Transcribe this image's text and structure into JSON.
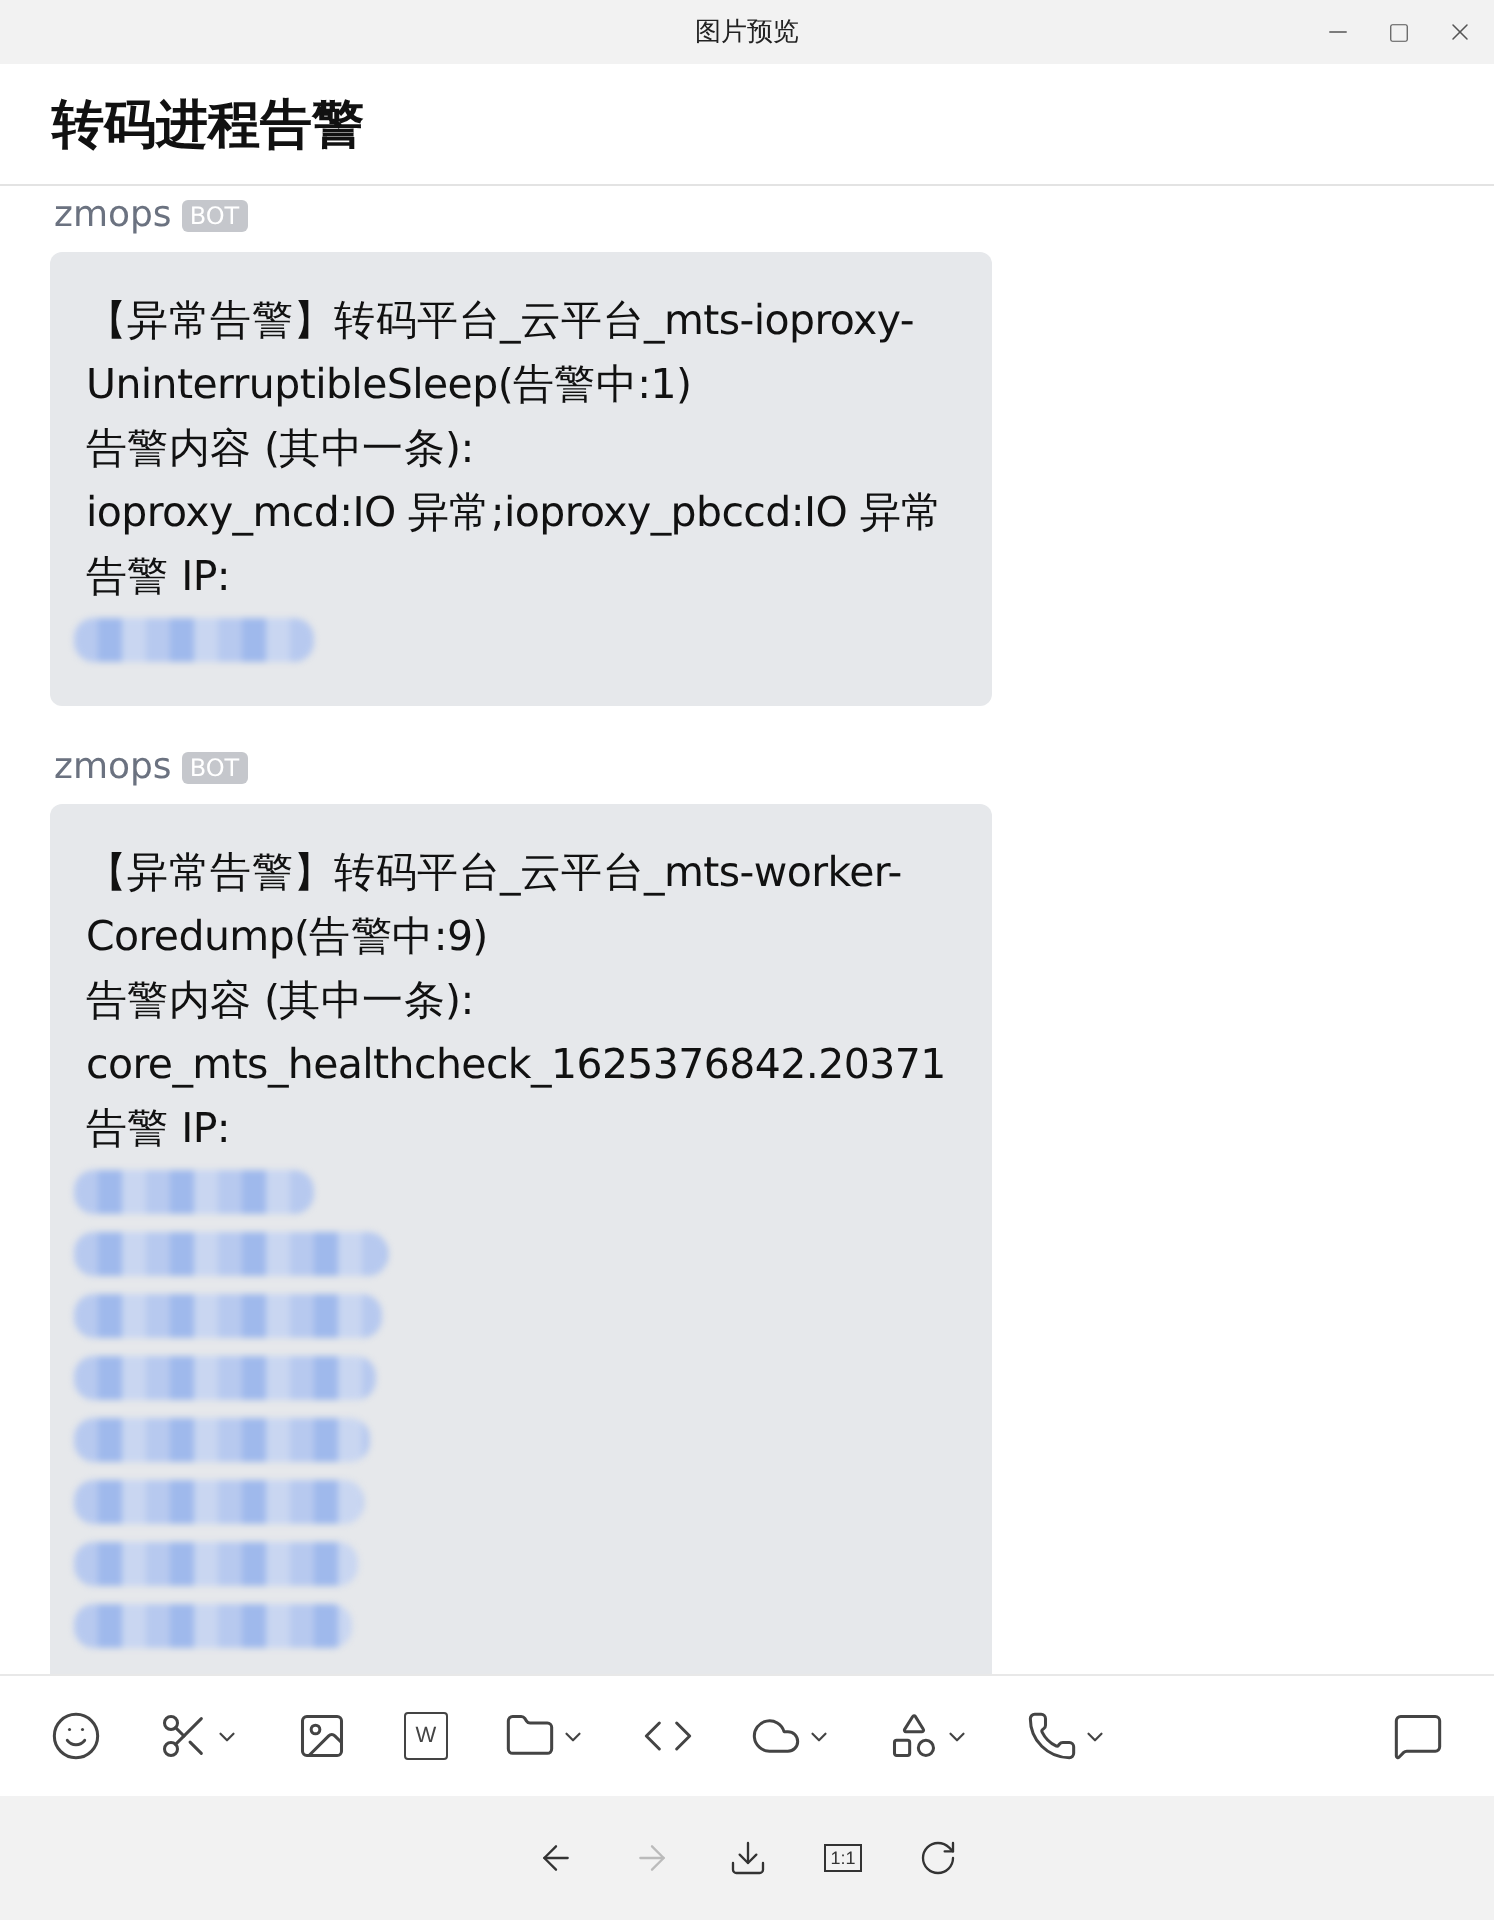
{
  "window": {
    "title": "图片预览",
    "controls": [
      {
        "kind": "minimize"
      },
      {
        "kind": "maximize"
      },
      {
        "kind": "close"
      }
    ]
  },
  "chat": {
    "title": "转码进程告警"
  },
  "messages": [
    {
      "sender": "zmops",
      "badge": "BOT",
      "lines": [
        "【异常告警】转码平台_云平台_mts-ioproxy-",
        "UninterruptibleSleep(告警中:1)",
        "告警内容 (其中一条):",
        "ioproxy_mcd:IO 异常;ioproxy_pbccd:IO 异常",
        "告警 IP:"
      ],
      "ip_rows": [
        {
          "kind": "redacted"
        }
      ]
    },
    {
      "sender": "zmops",
      "badge": "BOT",
      "lines": [
        "【异常告警】转码平台_云平台_mts-worker-",
        "Coredump(告警中:9)",
        "告警内容 (其中一条):",
        "core_mts_healthcheck_1625376842.20371",
        "告警 IP:"
      ],
      "ip_rows": [
        {
          "kind": "redacted"
        },
        {
          "kind": "redacted"
        },
        {
          "kind": "redacted"
        },
        {
          "kind": "redacted"
        },
        {
          "kind": "redacted"
        },
        {
          "kind": "redacted"
        },
        {
          "kind": "redacted"
        },
        {
          "kind": "redacted"
        }
      ]
    }
  ],
  "toolbar": [
    {
      "kind": "emoji",
      "dropdown": false
    },
    {
      "kind": "screenshot",
      "dropdown": true
    },
    {
      "kind": "image",
      "dropdown": false
    },
    {
      "kind": "document",
      "label": "W",
      "dropdown": false
    },
    {
      "kind": "folder",
      "dropdown": true
    },
    {
      "kind": "code",
      "dropdown": false
    },
    {
      "kind": "cloud-call",
      "dropdown": true
    },
    {
      "kind": "apps",
      "dropdown": true
    },
    {
      "kind": "phone",
      "dropdown": true
    },
    {
      "kind": "history",
      "dropdown": false
    }
  ],
  "viewer_bar": [
    {
      "kind": "back",
      "disabled": false
    },
    {
      "kind": "forward",
      "disabled": true
    },
    {
      "kind": "download",
      "disabled": false
    },
    {
      "kind": "actual-size",
      "label": "1:1",
      "disabled": false
    },
    {
      "kind": "rotate",
      "disabled": false
    }
  ]
}
